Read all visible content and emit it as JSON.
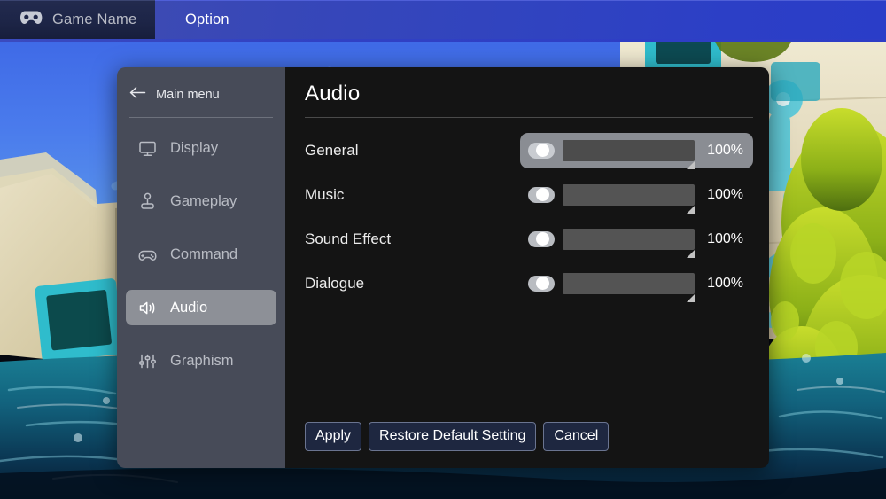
{
  "topbar": {
    "game_tab": {
      "label": "Game Name",
      "icon": "gamepad-icon"
    },
    "option_tab": {
      "label": "Option"
    }
  },
  "dialog": {
    "sidebar": {
      "back": {
        "label": "Main menu",
        "icon": "arrow-left-icon"
      },
      "items": [
        {
          "label": "Display",
          "icon": "monitor-icon",
          "active": false
        },
        {
          "label": "Gameplay",
          "icon": "joystick-icon",
          "active": false
        },
        {
          "label": "Command",
          "icon": "gamepad-icon",
          "active": false
        },
        {
          "label": "Audio",
          "icon": "speaker-icon",
          "active": true
        },
        {
          "label": "Graphism",
          "icon": "sliders-icon",
          "active": false
        }
      ]
    },
    "content": {
      "title": "Audio",
      "rows": [
        {
          "label": "General",
          "value": "100%",
          "toggle_on": false,
          "highlighted": true
        },
        {
          "label": "Music",
          "value": "100%",
          "toggle_on": false,
          "highlighted": false
        },
        {
          "label": "Sound Effect",
          "value": "100%",
          "toggle_on": false,
          "highlighted": false
        },
        {
          "label": "Dialogue",
          "value": "100%",
          "toggle_on": false,
          "highlighted": false
        }
      ]
    },
    "footer": {
      "apply": "Apply",
      "restore": "Restore Default Setting",
      "cancel": "Cancel"
    }
  },
  "colors": {
    "option_tab": "#3040c4",
    "game_tab": "#1d2547",
    "sidebar": "#474b58",
    "content": "#141414",
    "active_item": "#8d9097",
    "button_fill": "#1e2740",
    "button_border": "#6a7490",
    "slider_bar": "#545454",
    "sky": "#3f6fe8",
    "water": "#10647a",
    "foliage": "#9fc21e"
  }
}
